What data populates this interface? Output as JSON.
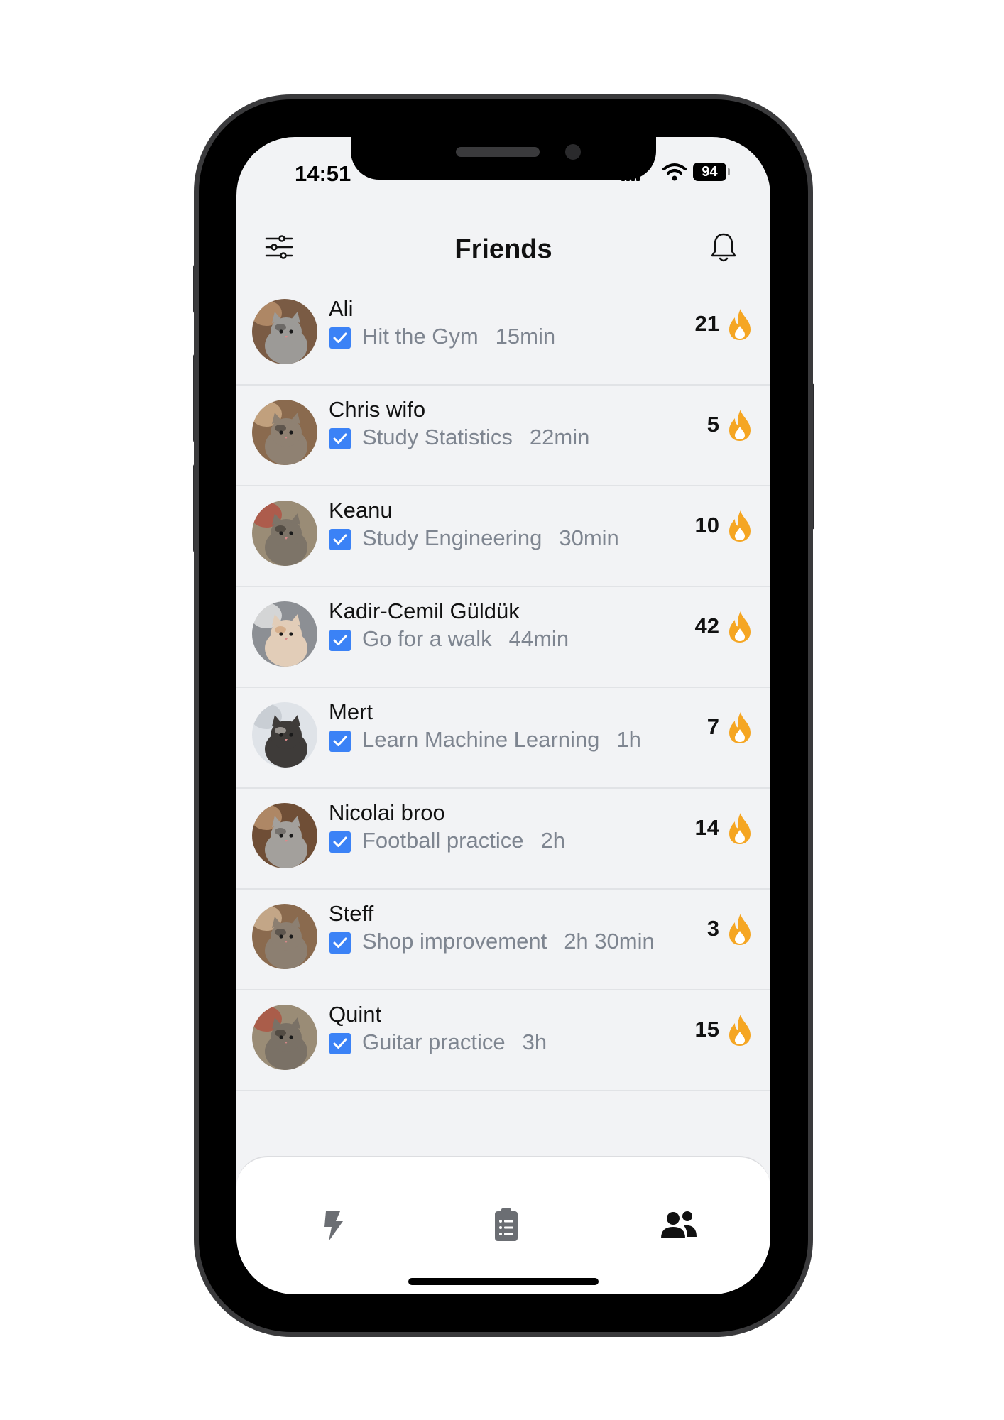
{
  "status_bar": {
    "time": "14:51",
    "battery": "94"
  },
  "header": {
    "title": "Friends",
    "left_icon": "sliders-icon",
    "right_icon": "bell-icon"
  },
  "friends": [
    {
      "name": "Ali",
      "task": "Hit the Gym",
      "duration": "15min",
      "streak": "21"
    },
    {
      "name": "Chris wifo",
      "task": "Study Statistics",
      "duration": "22min",
      "streak": "5"
    },
    {
      "name": "Keanu",
      "task": "Study Engineering",
      "duration": "30min",
      "streak": "10"
    },
    {
      "name": "Kadir-Cemil Güldük",
      "task": "Go for a walk",
      "duration": "44min",
      "streak": "42"
    },
    {
      "name": "Mert",
      "task": "Learn Machine Learning",
      "duration": "1h",
      "streak": "7"
    },
    {
      "name": "Nicolai broo",
      "task": "Football practice",
      "duration": "2h",
      "streak": "14"
    },
    {
      "name": "Steff",
      "task": "Shop improvement",
      "duration": "2h 30min",
      "streak": "3"
    },
    {
      "name": "Quint",
      "task": "Guitar practice",
      "duration": "3h",
      "streak": "15"
    }
  ],
  "tab_bar": [
    {
      "icon": "lightning-icon",
      "active": false
    },
    {
      "icon": "clipboard-list-icon",
      "active": false
    },
    {
      "icon": "users-icon",
      "active": true
    }
  ],
  "colors": {
    "check": "#3b82f6",
    "flame": "#f5a623",
    "background": "#f2f3f5"
  }
}
